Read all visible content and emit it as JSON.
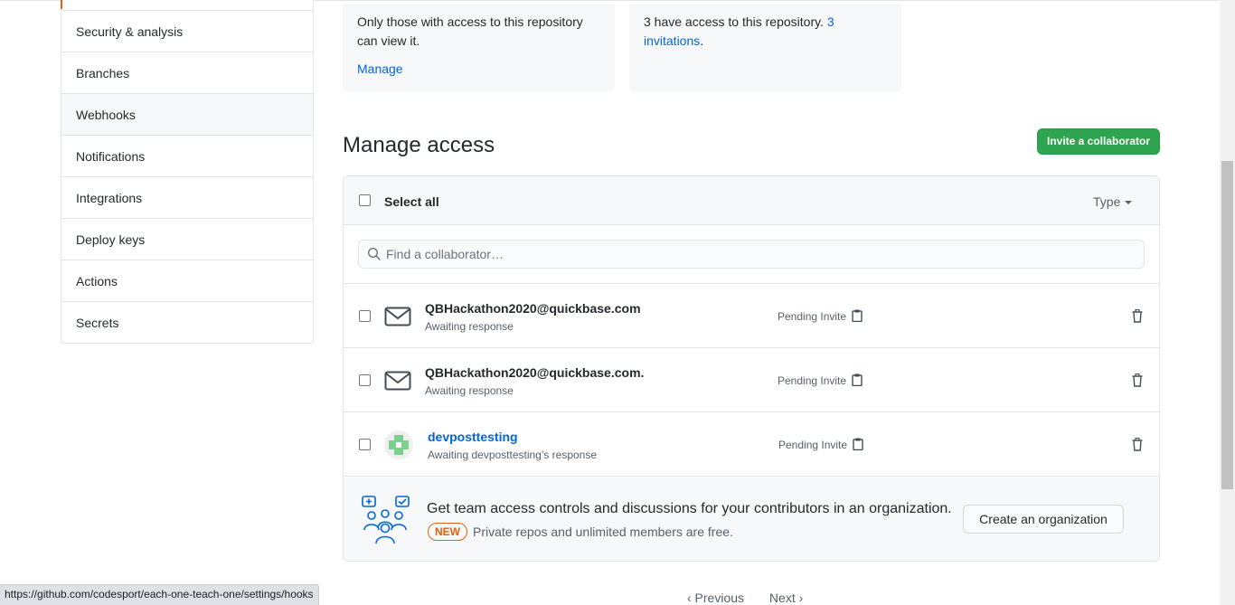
{
  "sidebar": {
    "items": [
      {
        "label": "Security & analysis"
      },
      {
        "label": "Branches"
      },
      {
        "label": "Webhooks"
      },
      {
        "label": "Notifications"
      },
      {
        "label": "Integrations"
      },
      {
        "label": "Deploy keys"
      },
      {
        "label": "Actions"
      },
      {
        "label": "Secrets"
      }
    ]
  },
  "cards": {
    "visibility_text": "Only those with access to this repository can view it.",
    "manage_link": "Manage",
    "access_count": "3",
    "access_text": " have access to this repository. ",
    "invitations_link": "3 invitations",
    "invitations_suffix": "."
  },
  "manage_access": {
    "title": "Manage access",
    "invite_button": "Invite a collaborator",
    "select_all": "Select all",
    "type_filter": "Type",
    "search_placeholder": "Find a collaborator…",
    "rows": [
      {
        "name": "QBHackathon2020@quickbase.com",
        "sub": "Awaiting response",
        "status": "Pending Invite"
      },
      {
        "name": "QBHackathon2020@quickbase.com.",
        "sub": "Awaiting response",
        "status": "Pending Invite"
      },
      {
        "name": "devposttesting",
        "sub": "Awaiting devposttesting’s response",
        "status": "Pending Invite"
      }
    ]
  },
  "promo": {
    "title": "Get team access controls and discussions for your contributors in an organization.",
    "badge": "NEW",
    "subtitle": "Private repos and unlimited members are free.",
    "button": "Create an organization"
  },
  "pagination": {
    "previous": "‹  Previous",
    "next": "Next  ›"
  },
  "status_bar_url": "https://github.com/codesport/each-one-teach-one/settings/hooks",
  "colors": {
    "accent_link": "#0366d6",
    "primary_button": "#2ea44f",
    "new_badge": "#e36209"
  }
}
